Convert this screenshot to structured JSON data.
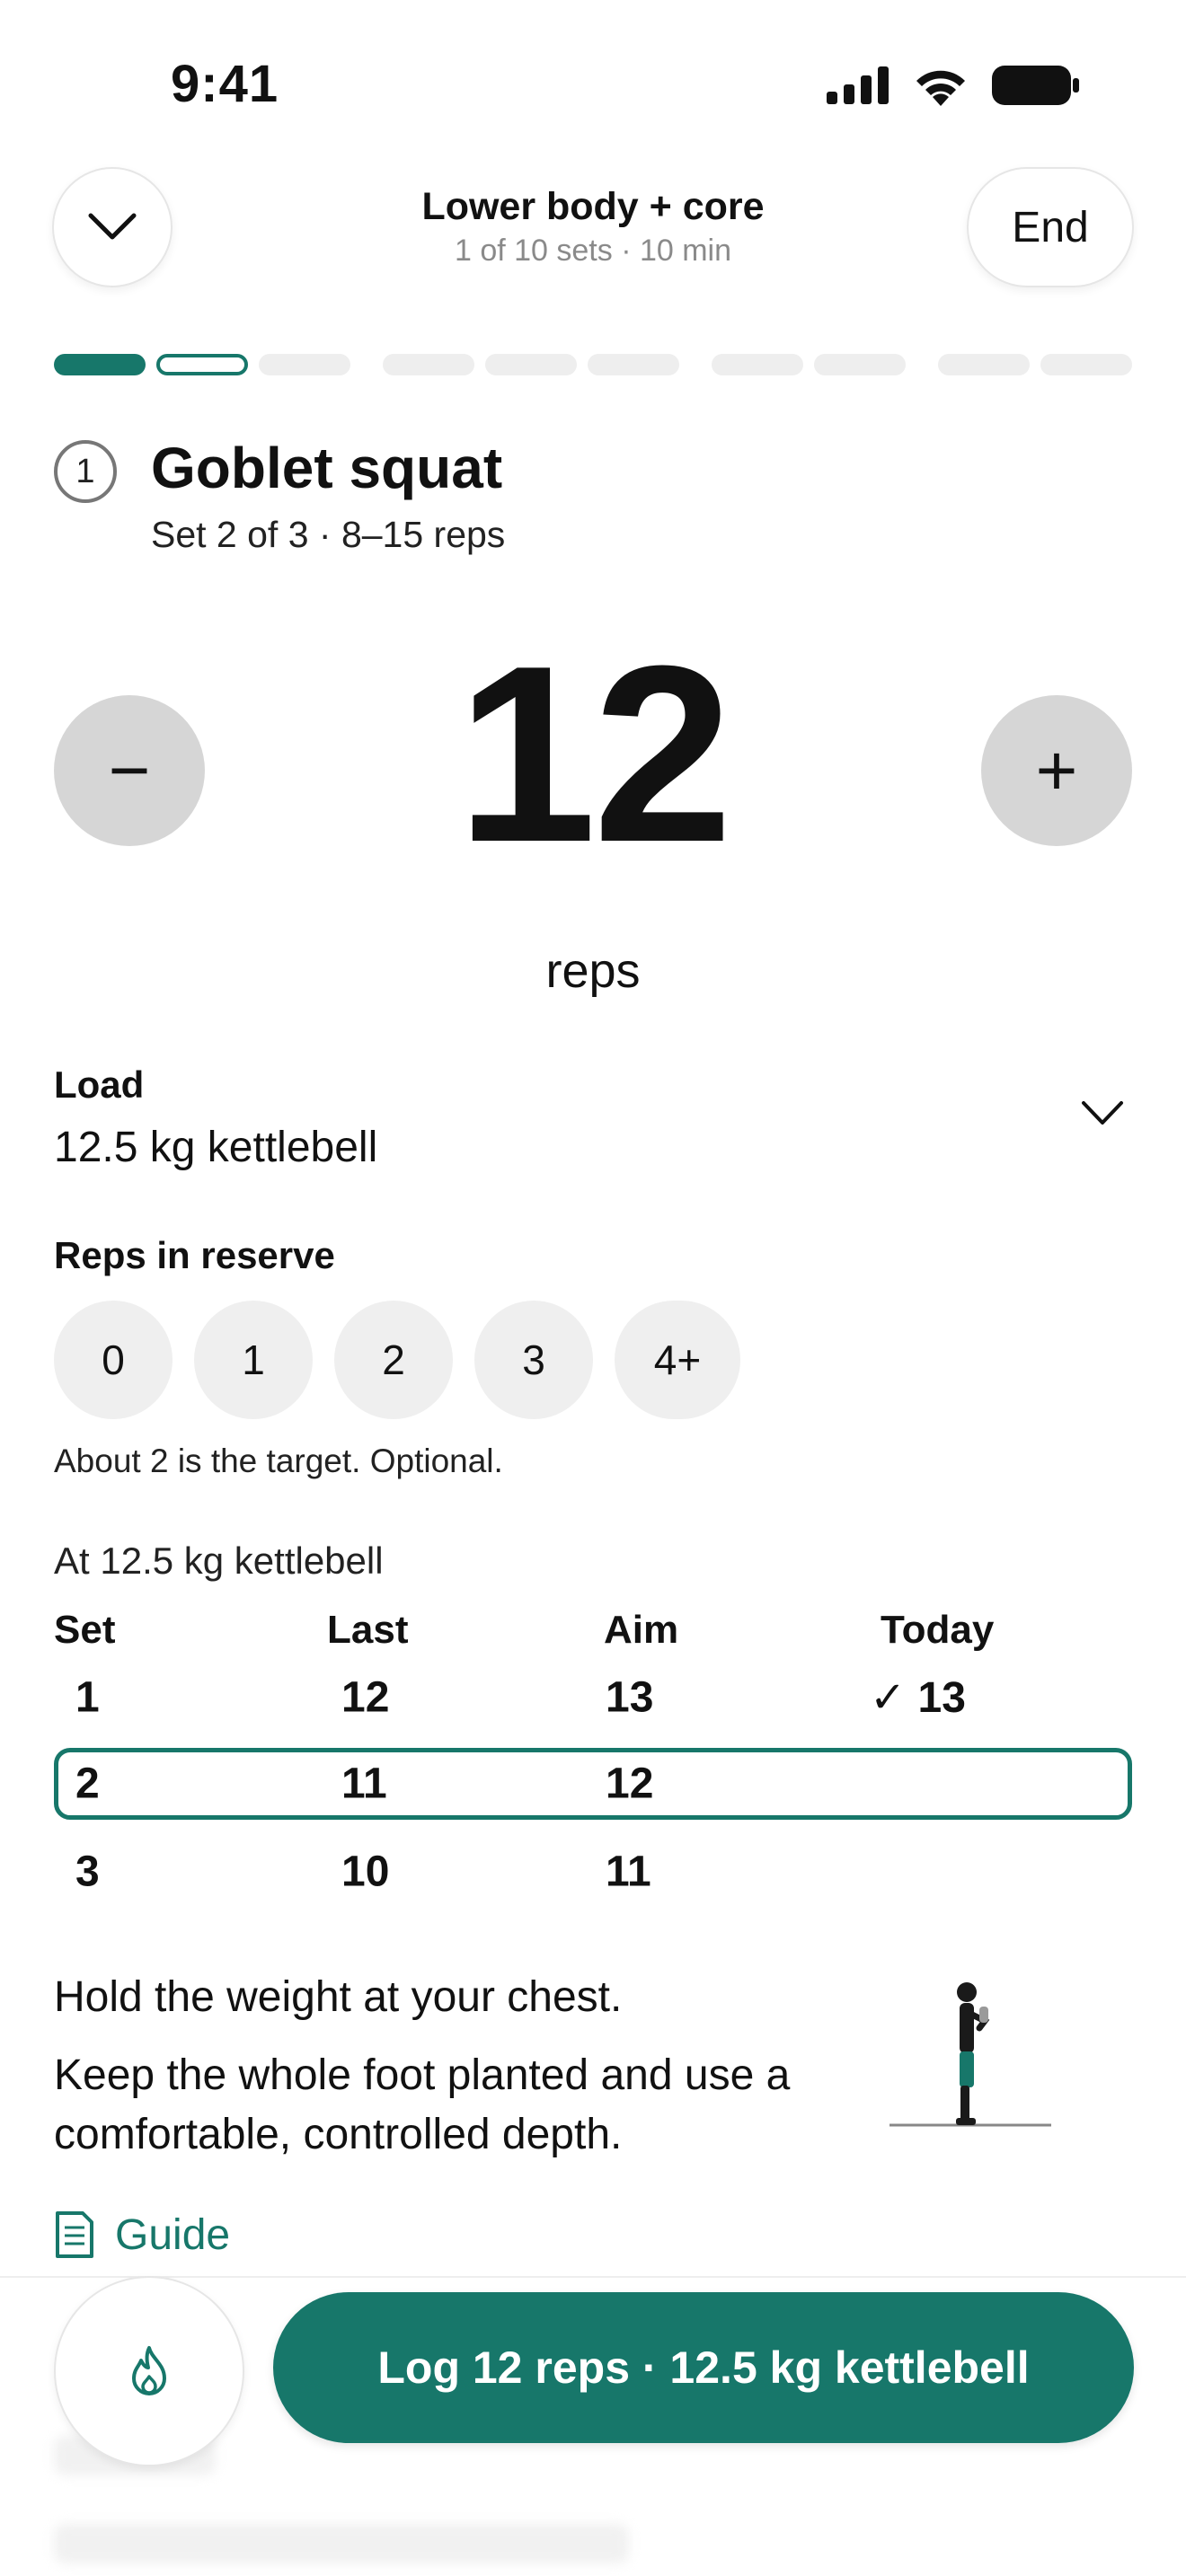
{
  "status_bar": {
    "time": "9:41"
  },
  "header": {
    "title": "Lower body + core",
    "subtitle": "1 of 10 sets · 10 min",
    "end_label": "End"
  },
  "progress": {
    "total_sets": 10,
    "completed": 1,
    "current_index": 1
  },
  "exercise": {
    "number": "1",
    "name": "Goblet squat",
    "detail": "Set 2 of 3 · 8–15 reps"
  },
  "counter": {
    "value": "12",
    "unit": "reps",
    "minus_label": "−",
    "plus_label": "+"
  },
  "load": {
    "label": "Load",
    "value": "12.5 kg kettlebell"
  },
  "rir": {
    "label": "Reps in reserve",
    "options": [
      "0",
      "1",
      "2",
      "3",
      "4+"
    ],
    "hint": "About 2 is the target. Optional."
  },
  "history": {
    "context": "At 12.5 kg kettlebell",
    "headers": {
      "set": "Set",
      "last": "Last",
      "aim": "Aim",
      "today": "Today"
    },
    "rows": [
      {
        "set": "1",
        "last": "12",
        "aim": "13",
        "today": "✓ 13"
      },
      {
        "set": "2",
        "last": "11",
        "aim": "12",
        "today": ""
      },
      {
        "set": "3",
        "last": "10",
        "aim": "11",
        "today": ""
      }
    ]
  },
  "instructions": {
    "line1": "Hold the weight at your chest.",
    "line2": "Keep the whole foot planted and use a comfortable, controlled depth."
  },
  "guide": {
    "label": "Guide"
  },
  "footer": {
    "log_label": "Log 12 reps · 12.5 kg kettlebell"
  },
  "colors": {
    "accent": "#17776a",
    "chip_bg": "#efefef",
    "stepper_bg": "#d6d6d6"
  }
}
